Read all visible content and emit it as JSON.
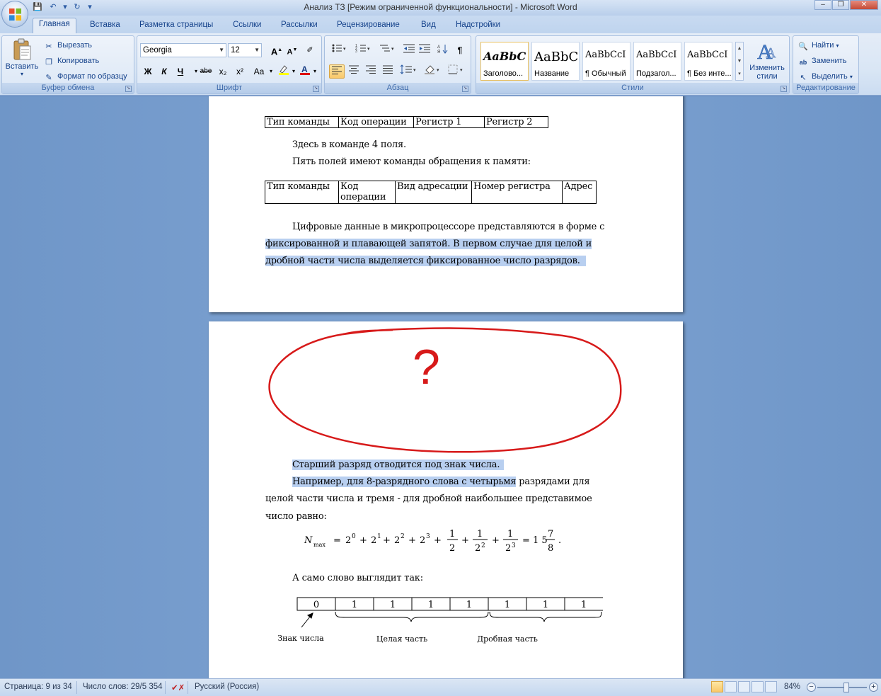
{
  "window": {
    "title": "Анализ ТЗ [Режим ограниченной функциональности] - Microsoft Word"
  },
  "tabs": [
    "Главная",
    "Вставка",
    "Разметка страницы",
    "Ссылки",
    "Рассылки",
    "Рецензирование",
    "Вид",
    "Надстройки"
  ],
  "ribbon": {
    "clipboard": {
      "paste": "Вставить",
      "cut": "Вырезать",
      "copy": "Копировать",
      "format_painter": "Формат по образцу",
      "label": "Буфер обмена"
    },
    "font": {
      "name": "Georgia",
      "size": "12",
      "label": "Шрифт",
      "bold": "Ж",
      "italic": "К",
      "underline": "Ч",
      "strike": "abe",
      "sub": "x₂",
      "sup": "x²",
      "case": "Aa"
    },
    "paragraph": {
      "label": "Абзац"
    },
    "styles": {
      "label": "Стили",
      "items": [
        {
          "sample": "AaBbC",
          "name": "Заголово..."
        },
        {
          "sample": "AaBbC",
          "name": "Название"
        },
        {
          "sample": "AaBbCcI",
          "name": "¶ Обычный"
        },
        {
          "sample": "AaBbCcI",
          "name": "Подзагол..."
        },
        {
          "sample": "AaBbCcI",
          "name": "¶ Без инте..."
        }
      ],
      "change": "Изменить стили"
    },
    "editing": {
      "label": "Редактирование",
      "find": "Найти",
      "replace": "Заменить",
      "select": "Выделить"
    }
  },
  "document": {
    "table1": [
      "Тип команды",
      "Код операции",
      "Регистр 1",
      "Регистр 2"
    ],
    "p1": "Здесь в команде 4 поля.",
    "p2": "Пять полей имеют команды обращения к памяти:",
    "table2": [
      "Тип команды",
      "Код операции",
      "Вид адресации",
      "Номер регистра",
      "Адрес"
    ],
    "p3_line1": "Цифровые данные в микропроцессоре представляются в форме с",
    "p3_line2": "фиксированной и плавающей запятой. В первом случае для целой и",
    "p3_line3": "дробной части числа выделяется фиксированное число разрядов.",
    "annotation": "?",
    "p4": "Старший разряд отводится под знак числа.",
    "p5_line1a": "Например, для 8-разрядного слова с четырьмя",
    "p5_line1b": " разрядами для",
    "p5_line2": "целой части числа и тремя - для дробной наибольшее представимое",
    "p5_line3": "число равно:",
    "p6": "А само слово выглядит так:",
    "bits": [
      "0",
      "1",
      "1",
      "1",
      "1",
      "1",
      "1",
      "1"
    ],
    "fig_labels": {
      "sign": "Знак числа",
      "int": "Целая часть",
      "frac": "Дробная часть"
    }
  },
  "status": {
    "page": "Страница: 9 из 34",
    "words": "Число слов: 29/5 354",
    "lang": "Русский (Россия)",
    "zoom": "84%"
  }
}
